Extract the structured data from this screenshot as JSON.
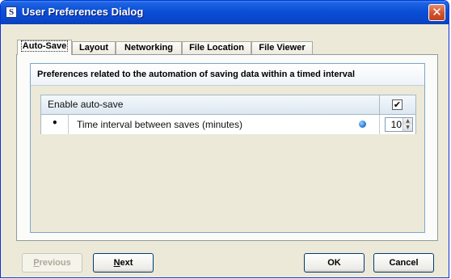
{
  "window": {
    "title": "User Preferences Dialog",
    "app_icon_letter": "S",
    "close_glyph": "✕"
  },
  "tabs": [
    {
      "label": "Auto-Save",
      "active": true
    },
    {
      "label": "Layout",
      "active": false
    },
    {
      "label": "Networking",
      "active": false
    },
    {
      "label": "File Location",
      "active": false
    },
    {
      "label": "File Viewer",
      "active": false
    }
  ],
  "section": {
    "header": "Preferences related to the automation of saving data within a timed interval"
  },
  "settings": {
    "enable_autosave": {
      "label": "Enable auto-save",
      "checked": true,
      "check_glyph": "✔"
    },
    "interval": {
      "bullet": "•",
      "label": "Time interval between saves (minutes)",
      "value": "10",
      "info_icon": "info-dot-icon"
    }
  },
  "buttons": {
    "previous_prefix": "",
    "previous_mnemonic": "P",
    "previous_rest": "revious",
    "next_mnemonic": "N",
    "next_rest": "ext",
    "ok": "OK",
    "cancel": "Cancel"
  },
  "colors": {
    "titlebar": "#0a4fd8",
    "dialog_bg": "#ece9d8",
    "section_border": "#7ea6c8"
  }
}
